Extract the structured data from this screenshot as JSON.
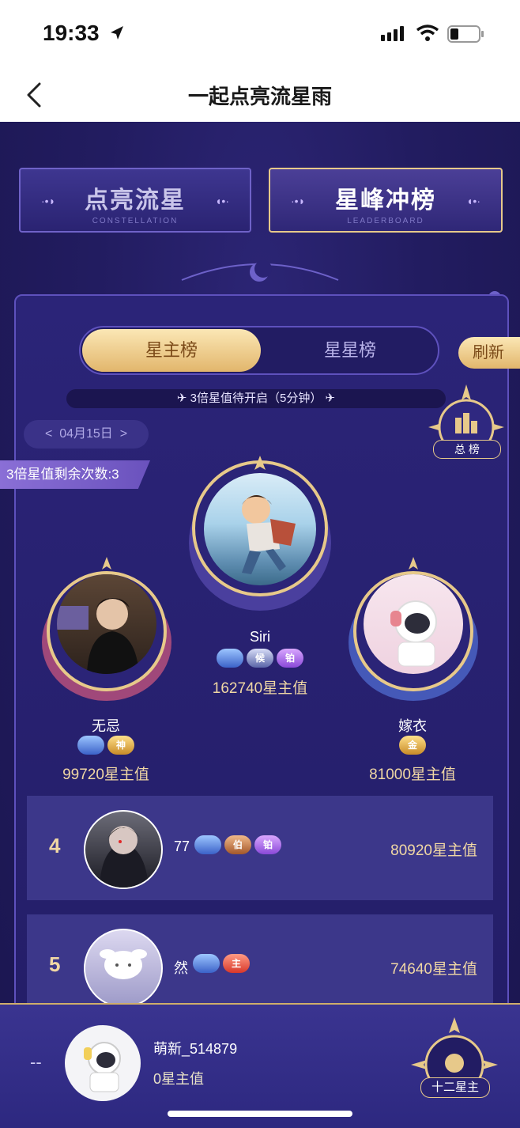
{
  "status": {
    "time": "19:33"
  },
  "nav": {
    "title": "一起点亮流星雨"
  },
  "modes": {
    "constellation": {
      "label": "点亮流星",
      "sub": "CONSTELLATION"
    },
    "leaderboard": {
      "label": "星峰冲榜",
      "sub": "LEADERBOARD"
    }
  },
  "segment": {
    "active": "星主榜",
    "inactive": "星星榜"
  },
  "refresh_label": "刷新",
  "notice": "3倍星值待开启（5分钟）",
  "date": {
    "prev": "<",
    "value": "04月15日",
    "next": ">"
  },
  "ribbon": "3倍星值剩余次数:3",
  "total_label": "总 榜",
  "podium": [
    {
      "rank": 1,
      "name": "Siri",
      "score": "162740星主值",
      "badges": [
        {
          "text": "",
          "color": "blue"
        },
        {
          "text": "候",
          "color": "silver"
        },
        {
          "text": "铂",
          "color": "purple"
        }
      ]
    },
    {
      "rank": 2,
      "name": "无忌",
      "score": "99720星主值",
      "badges": [
        {
          "text": "",
          "color": "blue"
        },
        {
          "text": "神",
          "color": "gold"
        }
      ]
    },
    {
      "rank": 3,
      "name": "嫁衣",
      "score": "81000星主值",
      "badges": [
        {
          "text": "金",
          "color": "gold"
        }
      ]
    }
  ],
  "list": [
    {
      "rank": "4",
      "name": "77",
      "score": "80920星主值",
      "badges": [
        {
          "text": "",
          "color": "blue"
        },
        {
          "text": "伯",
          "color": "bronze"
        },
        {
          "text": "铂",
          "color": "purple"
        }
      ]
    },
    {
      "rank": "5",
      "name": "然",
      "score": "74640星主值",
      "badges": [
        {
          "text": "",
          "color": "blue"
        },
        {
          "text": "主",
          "color": "red"
        }
      ]
    }
  ],
  "me": {
    "rank": "--",
    "name": "萌新_514879",
    "score": "0星主值"
  },
  "zodiac_label": "十二星主"
}
